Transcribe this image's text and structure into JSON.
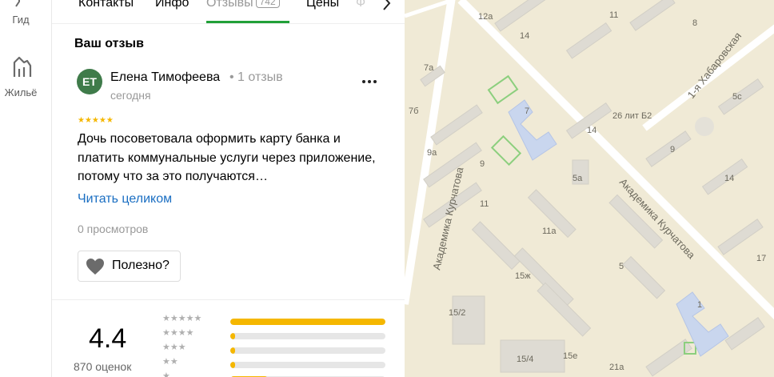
{
  "rail": {
    "items": [
      {
        "label": "Гид"
      },
      {
        "label": "Жильё"
      }
    ]
  },
  "tabs": {
    "items": [
      {
        "label": "Контакты"
      },
      {
        "label": "Инфо"
      },
      {
        "label": "Отзывы",
        "badge": "742"
      },
      {
        "label": "Цены"
      },
      {
        "label": "Ф"
      }
    ],
    "active": "Отзывы"
  },
  "review": {
    "section_title": "Ваш отзыв",
    "avatar_initials": "ЕТ",
    "author": "Елена Тимофеева",
    "author_meta": "• 1 отзыв",
    "date": "сегодня",
    "rating": 5,
    "text": "Дочь посоветовала оформить карту банка и платить коммунальные услуги через приложение, потому что за это получаются…",
    "read_more": "Читать целиком",
    "views": "0 просмотров",
    "useful_label": "Полезно?"
  },
  "summary": {
    "rating": "4.4",
    "count": "870 оценок",
    "distribution": [
      {
        "stars": 5,
        "fraction": 1.0
      },
      {
        "stars": 4,
        "fraction": 0.03
      },
      {
        "stars": 3,
        "fraction": 0.03
      },
      {
        "stars": 2,
        "fraction": 0.03
      },
      {
        "stars": 1,
        "fraction": 0.24
      }
    ]
  },
  "colors": {
    "accent_green": "#21a038",
    "star": "#f5b700",
    "link": "#1a6ec2",
    "map_bg": "#f0ead6"
  },
  "map": {
    "streets": [
      "1-я Хабаровская",
      "Академика Курчатова",
      "Академика Курчатова"
    ],
    "labels": [
      "12а",
      "11",
      "8",
      "14",
      "7а",
      "7б",
      "7",
      "26 лит Б2",
      "5с",
      "9а",
      "9",
      "14",
      "9",
      "5а",
      "14",
      "11",
      "11а",
      "5",
      "17",
      "15ж",
      "15/2",
      "15/4",
      "15е",
      "21а",
      "1"
    ]
  }
}
